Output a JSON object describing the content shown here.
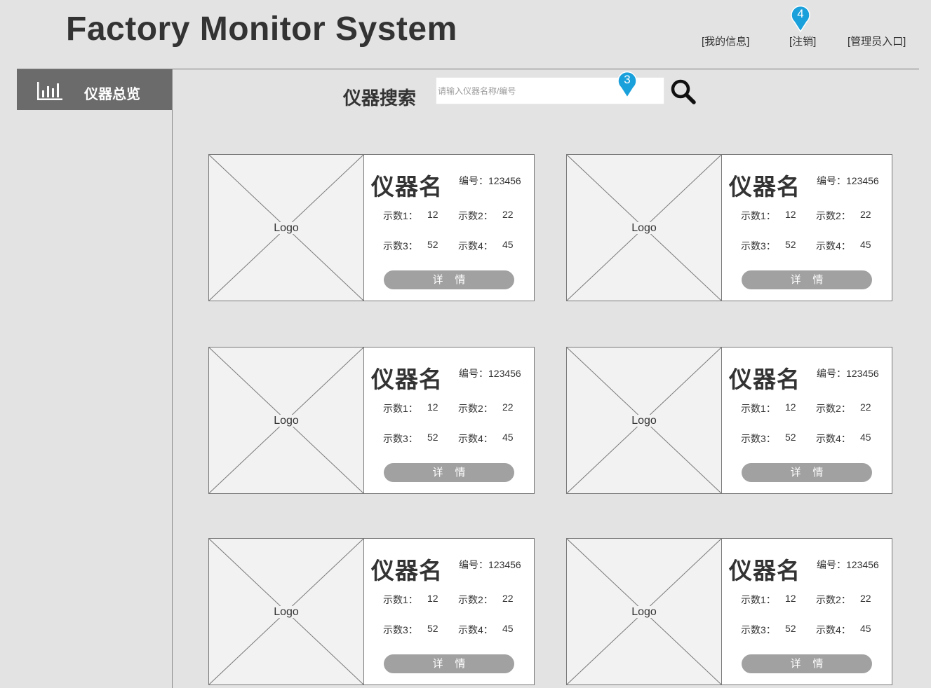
{
  "header": {
    "app_title": "Factory Monitor System",
    "links": {
      "my_info": "[我的信息]",
      "logout": "[注销]",
      "admin": "[管理员入口]"
    }
  },
  "sidebar": {
    "items": [
      {
        "label": "仪器总览",
        "icon": "bar-chart-icon"
      }
    ]
  },
  "search": {
    "label": "仪器搜索",
    "placeholder": "请输入仪器名称/编号",
    "value": ""
  },
  "markers": {
    "search": "3",
    "logout": "4"
  },
  "colors": {
    "background": "#e3e3e3",
    "sidebar_active": "#6b6b6b",
    "button": "#a1a1a1",
    "marker": "#1aa0db"
  },
  "instruments": [
    {
      "logo": "Logo",
      "name": "仪器名",
      "id_label": "编号：123456",
      "readings": [
        {
          "label": "示数1：",
          "value": "12"
        },
        {
          "label": "示数2：",
          "value": "22"
        },
        {
          "label": "示数3：",
          "value": "52"
        },
        {
          "label": "示数4：",
          "value": "45"
        }
      ],
      "button": "详    情"
    },
    {
      "logo": "Logo",
      "name": "仪器名",
      "id_label": "编号：123456",
      "readings": [
        {
          "label": "示数1：",
          "value": "12"
        },
        {
          "label": "示数2：",
          "value": "22"
        },
        {
          "label": "示数3：",
          "value": "52"
        },
        {
          "label": "示数4：",
          "value": "45"
        }
      ],
      "button": "详    情"
    },
    {
      "logo": "Logo",
      "name": "仪器名",
      "id_label": "编号：123456",
      "readings": [
        {
          "label": "示数1：",
          "value": "12"
        },
        {
          "label": "示数2：",
          "value": "22"
        },
        {
          "label": "示数3：",
          "value": "52"
        },
        {
          "label": "示数4：",
          "value": "45"
        }
      ],
      "button": "详    情"
    },
    {
      "logo": "Logo",
      "name": "仪器名",
      "id_label": "编号：123456",
      "readings": [
        {
          "label": "示数1：",
          "value": "12"
        },
        {
          "label": "示数2：",
          "value": "22"
        },
        {
          "label": "示数3：",
          "value": "52"
        },
        {
          "label": "示数4：",
          "value": "45"
        }
      ],
      "button": "详    情"
    },
    {
      "logo": "Logo",
      "name": "仪器名",
      "id_label": "编号：123456",
      "readings": [
        {
          "label": "示数1：",
          "value": "12"
        },
        {
          "label": "示数2：",
          "value": "22"
        },
        {
          "label": "示数3：",
          "value": "52"
        },
        {
          "label": "示数4：",
          "value": "45"
        }
      ],
      "button": "详    情"
    },
    {
      "logo": "Logo",
      "name": "仪器名",
      "id_label": "编号：123456",
      "readings": [
        {
          "label": "示数1：",
          "value": "12"
        },
        {
          "label": "示数2：",
          "value": "22"
        },
        {
          "label": "示数3：",
          "value": "52"
        },
        {
          "label": "示数4：",
          "value": "45"
        }
      ],
      "button": "详    情"
    }
  ]
}
